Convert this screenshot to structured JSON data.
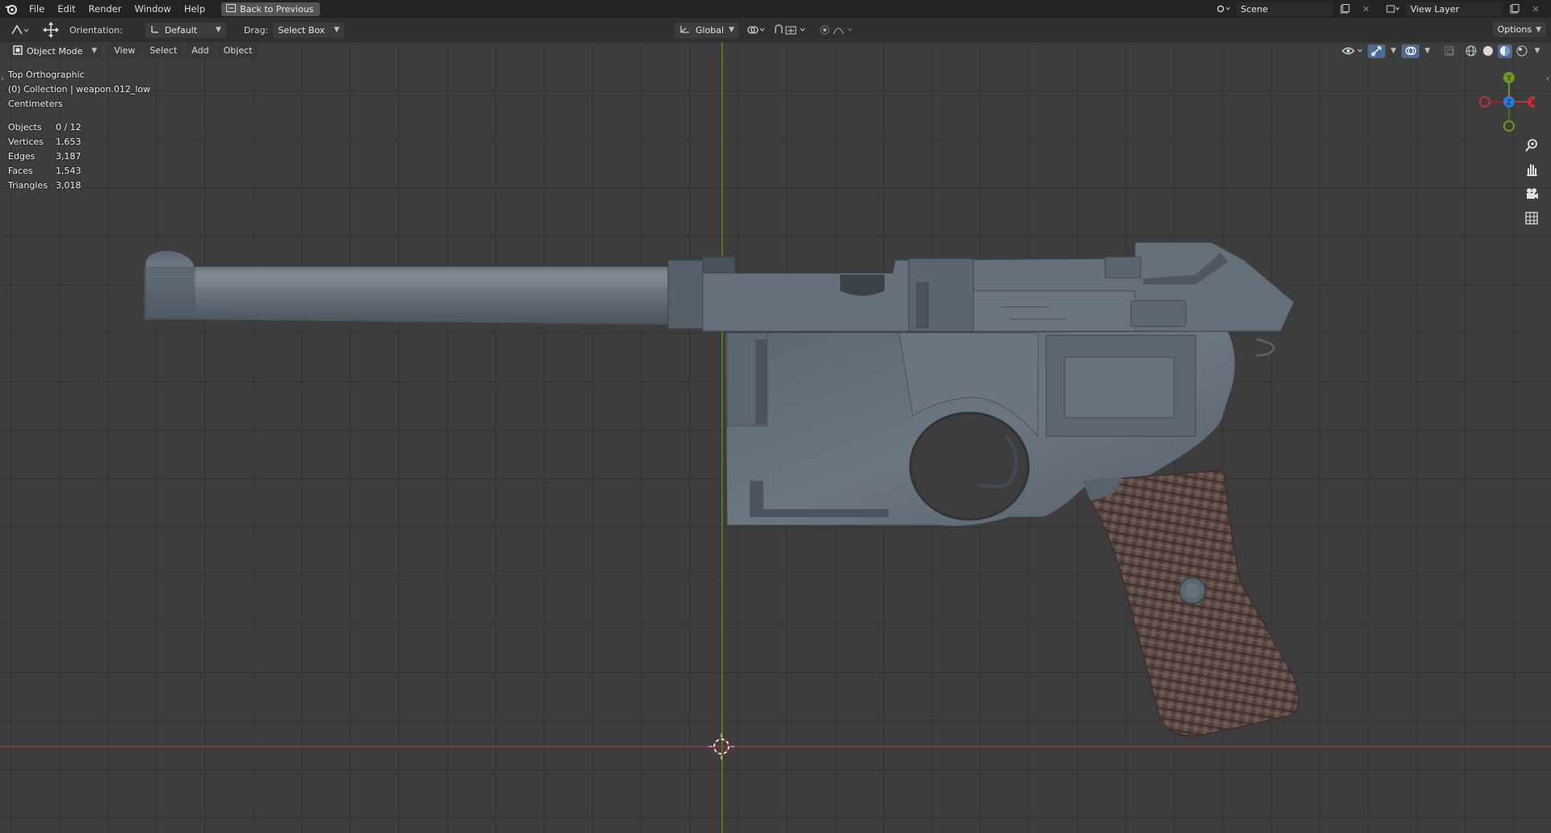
{
  "topbar": {
    "menus": [
      "File",
      "Edit",
      "Render",
      "Window",
      "Help"
    ],
    "back_label": "Back to Previous",
    "scene": "Scene",
    "view_layer": "View Layer"
  },
  "toolbar": {
    "orientation_label": "Orientation:",
    "orientation_value": "Default",
    "drag_label": "Drag:",
    "drag_value": "Select Box",
    "transform_space": "Global",
    "options_label": "Options"
  },
  "header": {
    "mode": "Object Mode",
    "menus": [
      "View",
      "Select",
      "Add",
      "Object"
    ]
  },
  "viewport": {
    "view_name": "Top Orthographic",
    "collection": "(0) Collection | weapon.012_low",
    "units": "Centimeters",
    "stats": [
      {
        "label": "Objects",
        "value": "0 / 12"
      },
      {
        "label": "Vertices",
        "value": "1,653"
      },
      {
        "label": "Edges",
        "value": "3,187"
      },
      {
        "label": "Faces",
        "value": "1,543"
      },
      {
        "label": "Triangles",
        "value": "3,018"
      }
    ],
    "gizmo_axes": {
      "y": "Y",
      "z": "Z",
      "x": "X"
    }
  },
  "colors": {
    "axis_x": "#c0303c",
    "axis_y": "#6a9a22",
    "axis_z": "#2a7ad8",
    "grid": "#353535",
    "bg": "#3d3d3d"
  },
  "icons": [
    "blender-logo-icon",
    "back-icon",
    "editor-type-icon",
    "transform-icon",
    "orientation-icon",
    "global-icon",
    "snap-icon",
    "proportional-icon",
    "visibility-icon",
    "gizmo-icon",
    "overlay-icon",
    "xray-icon",
    "shading-wire-icon",
    "shading-solid-icon",
    "shading-material-icon",
    "shading-rendered-icon",
    "zoom-icon",
    "pan-icon",
    "camera-icon",
    "ortho-grid-icon",
    "3d-cursor-icon"
  ]
}
